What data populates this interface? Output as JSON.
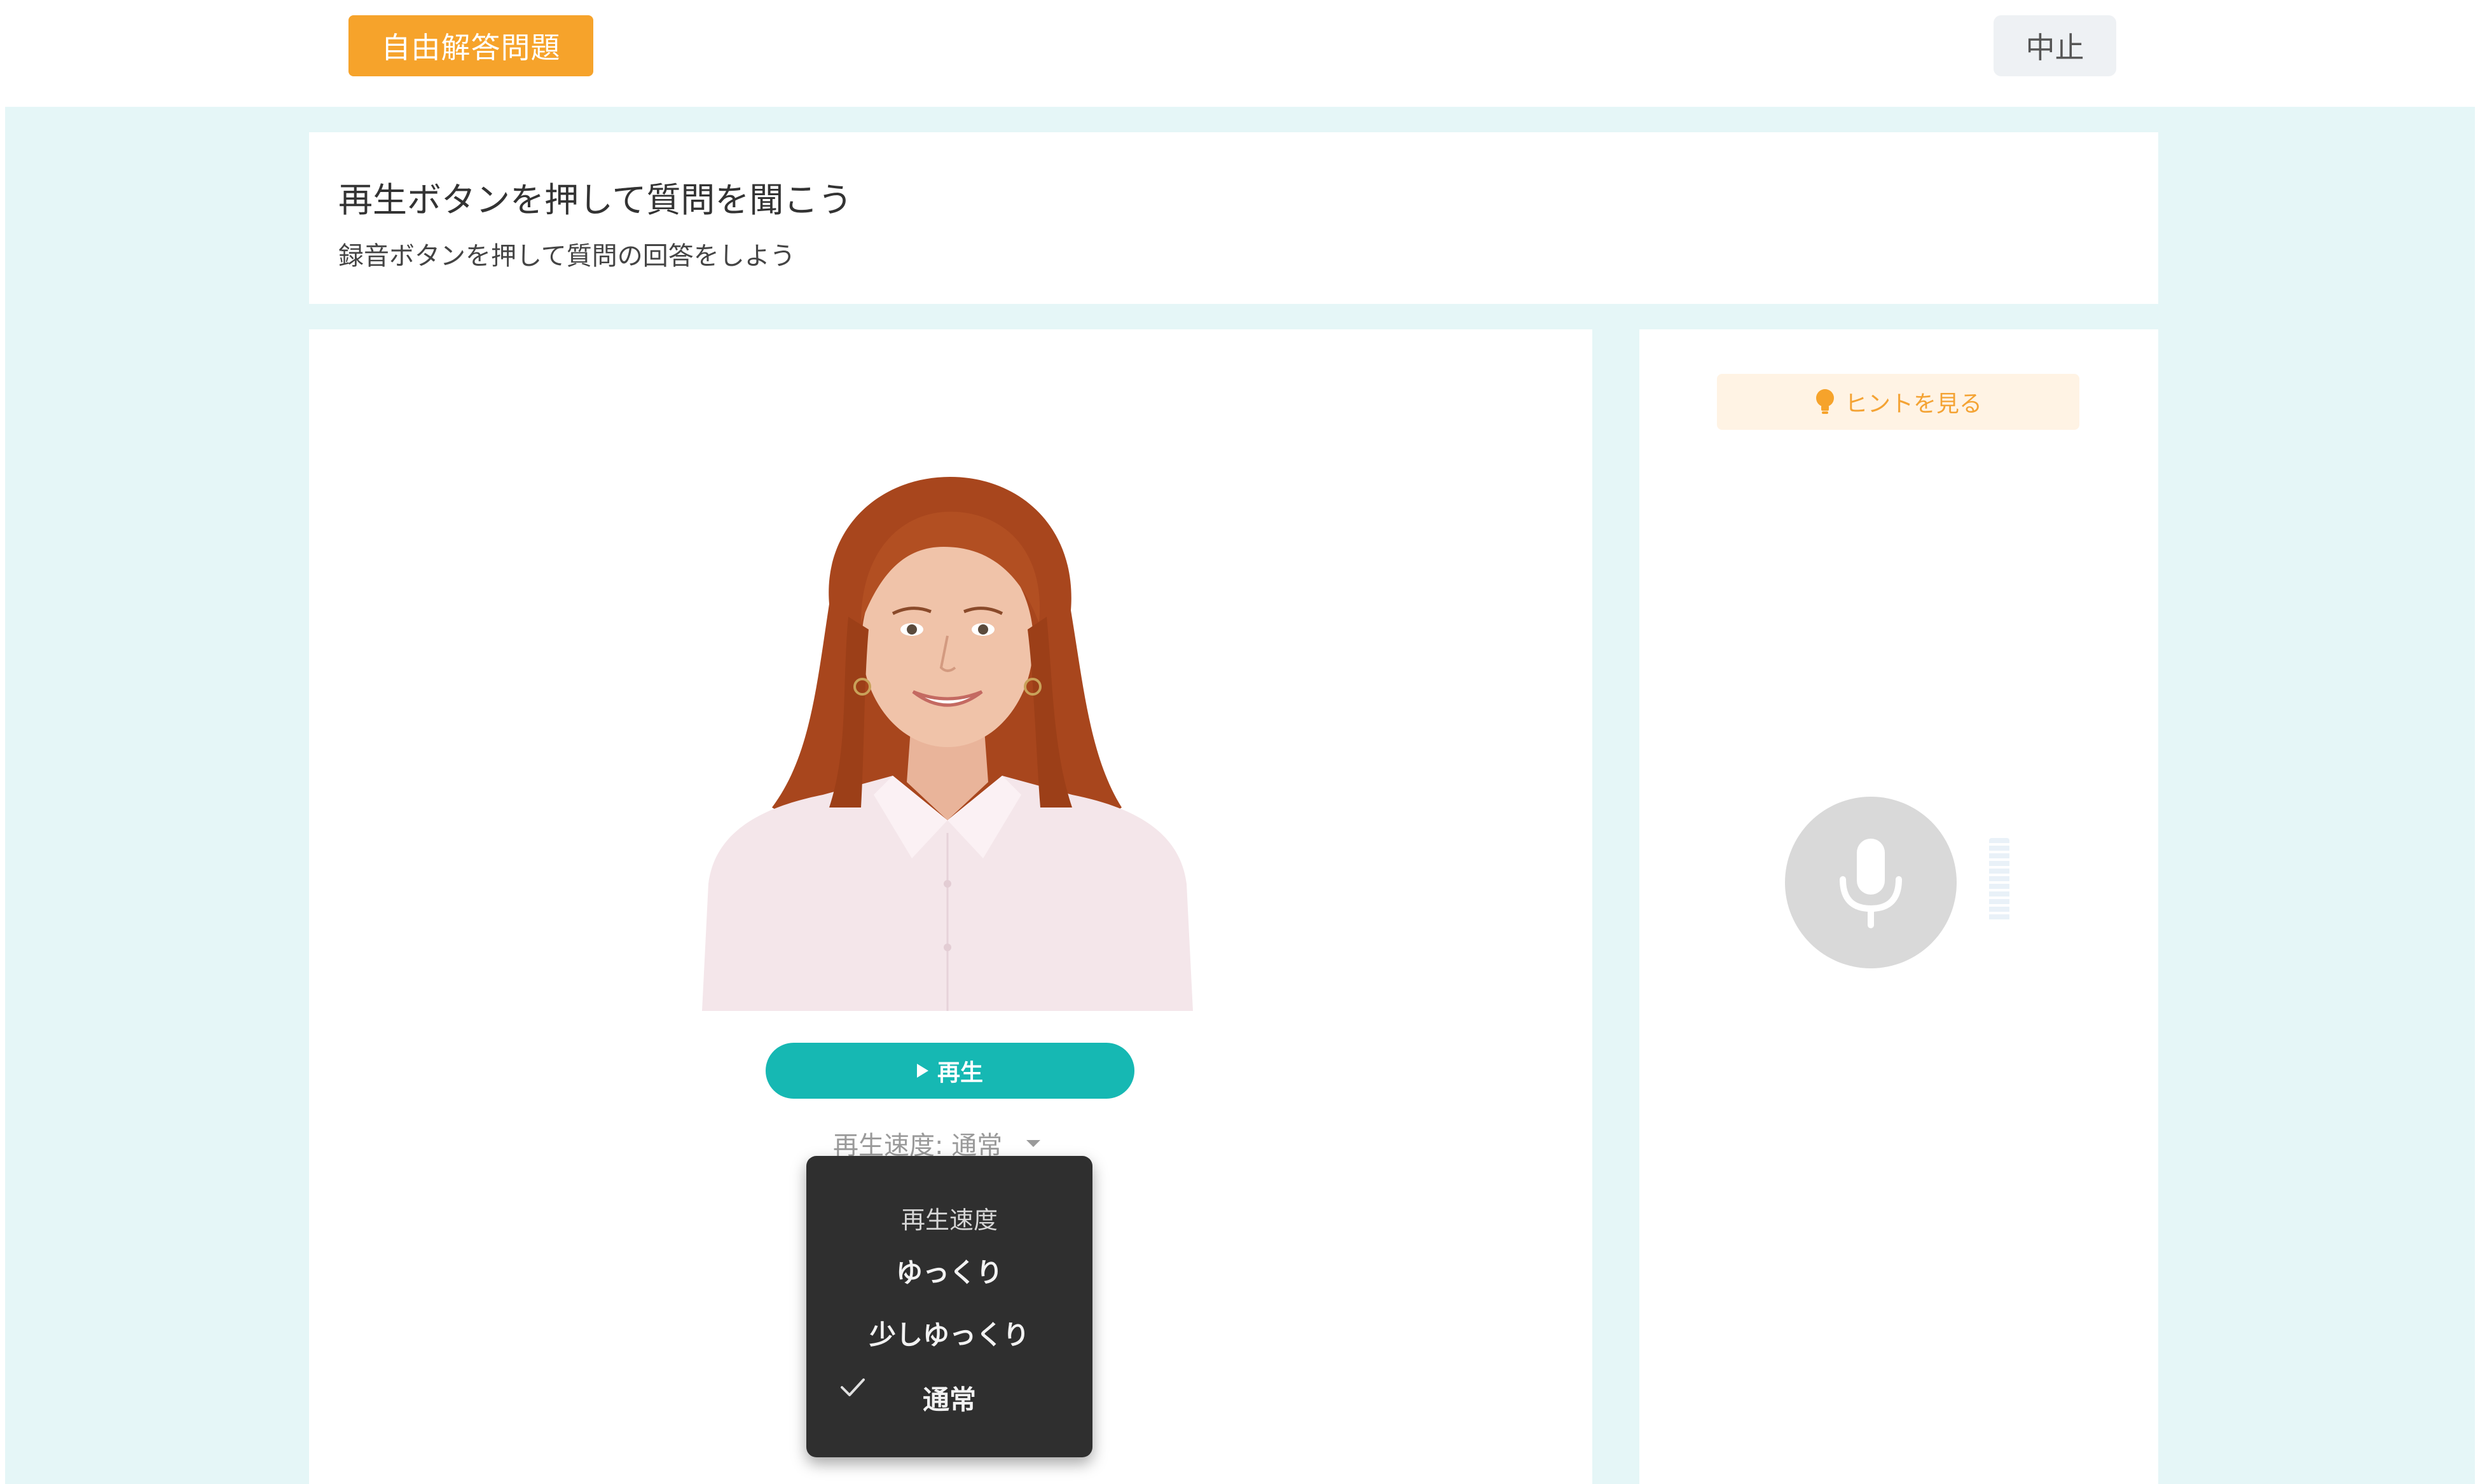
{
  "header": {
    "mode_label": "自由解答問題",
    "stop_label": "中止"
  },
  "instructions": {
    "title": "再生ボタンを押して質問を聞こう",
    "subtitle": "録音ボタンを押して質問の回答をしよう"
  },
  "player": {
    "play_label": "再生",
    "speed_display": "再生速度: 通常",
    "speed_menu": {
      "header": "再生速度",
      "options": [
        "ゆっくり",
        "少しゆっくり",
        "通常"
      ],
      "selected": "通常"
    }
  },
  "side": {
    "hint_label": "ヒントを見る"
  },
  "icons": {
    "play": "play-icon",
    "check": "check-icon",
    "bulb": "lightbulb-icon",
    "mic": "microphone-icon",
    "caret": "chevron-down-icon"
  },
  "colors": {
    "accent_orange": "#f6a32b",
    "play_teal": "#16b8b3",
    "page_bg": "#e5f6f7",
    "menu_bg": "#2f2f2f",
    "hint_bg": "#fff3e4"
  }
}
